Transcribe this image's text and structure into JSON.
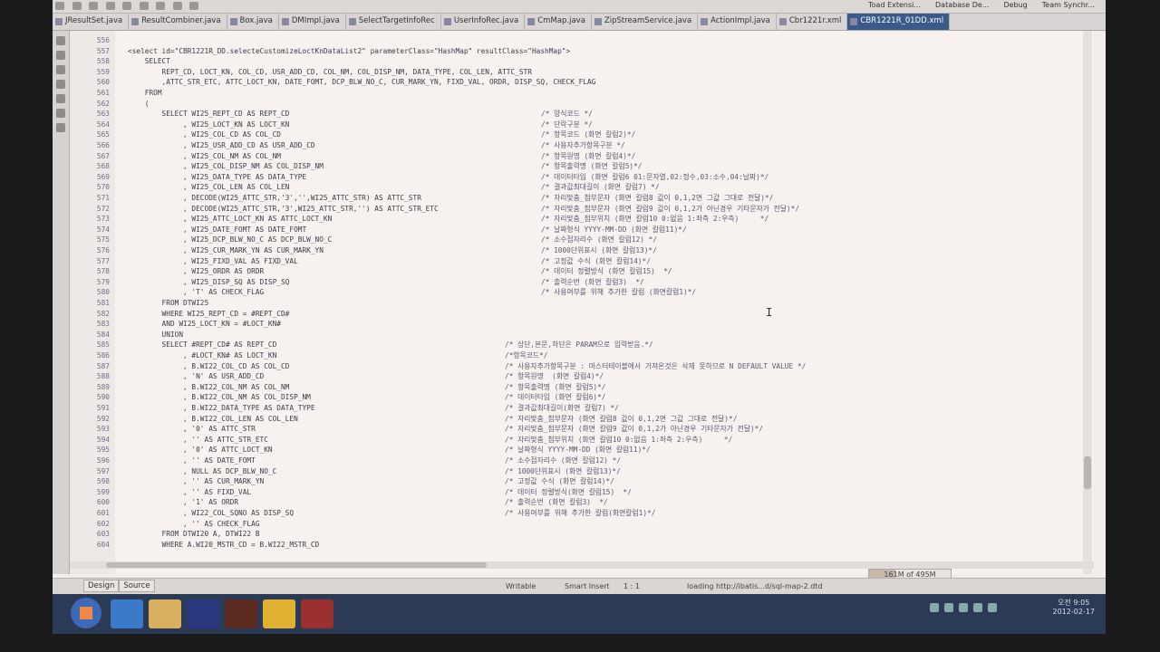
{
  "perspectives": [
    "Toad Extensi...",
    "Database De...",
    "Debug",
    "Team Synchr..."
  ],
  "tabs": [
    {
      "label": "JResultSet.java",
      "active": false
    },
    {
      "label": "ResultCombiner.java",
      "active": false
    },
    {
      "label": "Box.java",
      "active": false
    },
    {
      "label": "DMImpl.java",
      "active": false
    },
    {
      "label": "SelectTargetInfoRec",
      "active": false
    },
    {
      "label": "UserInfoRec.java",
      "active": false
    },
    {
      "label": "CmMap.java",
      "active": false
    },
    {
      "label": "ZipStreamService.java",
      "active": false
    },
    {
      "label": "ActionImpl.java",
      "active": false
    },
    {
      "label": "Cbr1221r.xml",
      "active": false
    },
    {
      "label": "CBR1221R_01DD.xml",
      "active": true
    }
  ],
  "lines": [
    {
      "n": "556",
      "code": "",
      "comment": ""
    },
    {
      "n": "557",
      "code": "<select id=\"CBR1221R_DD.selecteCustomizeLoctKnDataList2\" parameterClass=\"HashMap\" resultClass=\"HashMap\">",
      "comment": ""
    },
    {
      "n": "558",
      "code": "    SELECT",
      "comment": ""
    },
    {
      "n": "559",
      "code": "        REPT_CD, LOCT_KN, COL_CD, USR_ADD_CD, COL_NM, COL_DISP_NM, DATA_TYPE, COL_LEN, ATTC_STR",
      "comment": ""
    },
    {
      "n": "560",
      "code": "        ,ATTC_STR_ETC, ATTC_LOCT_KN, DATE_FOMT, DCP_BLW_NO_C, CUR_MARK_YN, FIXD_VAL, ORDR, DISP_SQ, CHECK_FLAG",
      "comment": ""
    },
    {
      "n": "561",
      "code": "    FROM",
      "comment": ""
    },
    {
      "n": "562",
      "code": "    (",
      "comment": ""
    },
    {
      "n": "563",
      "code": "        SELECT WI25_REPT_CD AS REPT_CD",
      "comment": "/* 양식코드 */"
    },
    {
      "n": "564",
      "code": "             , WI25_LOCT_KN AS LOCT_KN",
      "comment": "/* 단락구분 */"
    },
    {
      "n": "565",
      "code": "             , WI25_COL_CD AS COL_CD",
      "comment": "/* 항목코드 (화면 칼럼2)*/"
    },
    {
      "n": "566",
      "code": "             , WI25_USR_ADD_CD AS USR_ADD_CD",
      "comment": "/* 사용자추가항목구분 */"
    },
    {
      "n": "567",
      "code": "             , WI25_COL_NM AS COL_NM",
      "comment": "/* 항목원명 (화면 칼럼4)*/"
    },
    {
      "n": "568",
      "code": "             , WI25_COL_DISP_NM AS COL_DISP_NM",
      "comment": "/* 항목출력명 (화면 칼럼5)*/"
    },
    {
      "n": "569",
      "code": "             , WI25_DATA_TYPE AS DATA_TYPE",
      "comment": "/* 데이터타입 (화면 칼럼6 01:문자열,02:정수,03:소수,04:날짜)*/"
    },
    {
      "n": "570",
      "code": "             , WI25_COL_LEN AS COL_LEN",
      "comment": "/* 결과값최대길이 (화면 칼럼7) */"
    },
    {
      "n": "571",
      "code": "             , DECODE(WI25_ATTC_STR,'3','',WI25_ATTC_STR) AS ATTC_STR",
      "comment": "/* 자리맞춤_첨부문자 (화면 칼럼8 값이 0,1,2면 그값 그대로 전달)*/"
    },
    {
      "n": "572",
      "code": "             , DECODE(WI25_ATTC_STR,'3',WI25_ATTC_STR,'') AS ATTC_STR_ETC",
      "comment": "/* 자리맞춤_첨부문자 (화면 칼럼9 값이 0,1,2가 아닌경우 기타문자가 전달)*/"
    },
    {
      "n": "573",
      "code": "             , WI25_ATTC_LOCT_KN AS ATTC_LOCT_KN",
      "comment": "/* 자리맞춤_첨부위치 (화면 칼럼10 0:없음 1:좌측 2:우측)     */"
    },
    {
      "n": "574",
      "code": "             , WI25_DATE_FOMT AS DATE_FOMT",
      "comment": "/* 날짜형식 YYYY-MM-DD (화면 칼럼11)*/"
    },
    {
      "n": "575",
      "code": "             , WI25_DCP_BLW_NO_C AS DCP_BLW_NO_C",
      "comment": "/* 소수점자리수 (화면 칼럼12) */"
    },
    {
      "n": "576",
      "code": "             , WI25_CUR_MARK_YN AS CUR_MARK_YN",
      "comment": "/* 1000단위표시 (화면 칼럼13)*/"
    },
    {
      "n": "577",
      "code": "             , WI25_FIXD_VAL AS FIXD_VAL",
      "comment": "/* 고정값 수식 (화면 칼럼14)*/"
    },
    {
      "n": "578",
      "code": "             , WI25_ORDR AS ORDR",
      "comment": "/* 데이터 정렬방식 (화면 칼럼15)  */"
    },
    {
      "n": "579",
      "code": "             , WI25_DISP_SQ AS DISP_SQ",
      "comment": "/* 출력순번 (화면 칼럼3)  */"
    },
    {
      "n": "580",
      "code": "             , 'T' AS CHECK_FLAG",
      "comment": "/* 사용여부를 위해 추가한 칼럼 (화면칼럼1)*/"
    },
    {
      "n": "581",
      "code": "        FROM DTWI25",
      "comment": ""
    },
    {
      "n": "582",
      "code": "        WHERE WI25_REPT_CD = #REPT_CD#",
      "comment": ""
    },
    {
      "n": "583",
      "code": "        AND WI25_LOCT_KN = #LOCT_KN#",
      "comment": ""
    },
    {
      "n": "584",
      "code": "        UNION",
      "comment": ""
    },
    {
      "n": "585",
      "code": "        SELECT #REPT_CD# AS REPT_CD",
      "comment": "/* 상단,본문,하단은 PARAM으로 입력받음.*/"
    },
    {
      "n": "586",
      "code": "             , #LOCT_KN# AS LOCT_KN",
      "comment": "/*항목코드*/"
    },
    {
      "n": "587",
      "code": "             , B.WI22_COL_CD AS COL_CD",
      "comment": "/* 사용자추가항목구분 : 마스터테이블에서 가져온것은 삭제 못하므로 N DEFAULT VALUE */"
    },
    {
      "n": "588",
      "code": "             , 'N' AS USR_ADD_CD",
      "comment": "/* 항목원명  (화면 칼럼4)*/"
    },
    {
      "n": "589",
      "code": "             , B.WI22_COL_NM AS COL_NM",
      "comment": "/* 항목출력명 (화면 칼럼5)*/"
    },
    {
      "n": "590",
      "code": "             , B.WI22_COL_NM AS COL_DISP_NM",
      "comment": "/* 데이터타입 (화면 칼럼6)*/"
    },
    {
      "n": "591",
      "code": "             , B.WI22_DATA_TYPE AS DATA_TYPE",
      "comment": "/* 결과값최대길이(화면 칼럼7) */"
    },
    {
      "n": "592",
      "code": "             , B.WI22_COL_LEN AS COL_LEN",
      "comment": "/* 자리맞춤_첨부문자 (화면 칼럼8 값이 0,1,2면 그값 그대로 전달)*/"
    },
    {
      "n": "593",
      "code": "             , '0' AS ATTC_STR",
      "comment": "/* 자리맞춤_첨부문자 (화면 칼럼9 값이 0,1,2가 아닌경우 기타문자가 전달)*/"
    },
    {
      "n": "594",
      "code": "             , '' AS ATTC_STR_ETC",
      "comment": "/* 자리맞춤_첨부위치 (화면 칼럼10 0:없음 1:좌측 2:우측)     */"
    },
    {
      "n": "595",
      "code": "             , '0' AS ATTC_LOCT_KN",
      "comment": "/* 날짜형식 YYYY-MM-DD (화면 칼럼11)*/"
    },
    {
      "n": "596",
      "code": "             , '' AS DATE_FOMT",
      "comment": "/* 소수점자리수 (화면 칼럼12) */"
    },
    {
      "n": "597",
      "code": "             , NULL AS DCP_BLW_NO_C",
      "comment": "/* 1000단위표시 (화면 칼럼13)*/"
    },
    {
      "n": "598",
      "code": "             , '' AS CUR_MARK_YN",
      "comment": "/* 고정값 수식 (화면 칼럼14)*/"
    },
    {
      "n": "599",
      "code": "             , '' AS FIXD_VAL",
      "comment": "/* 데이터 정렬방식(화면 칼럼15)  */"
    },
    {
      "n": "600",
      "code": "             , '1' AS ORDR",
      "comment": "/* 출력순번 (화면 칼럼3)  */"
    },
    {
      "n": "601",
      "code": "             , WI22_COL_SQNO AS DISP_SQ",
      "comment": "/* 사용여부를 위해 추가한 칼럼(화면칼럼1)*/"
    },
    {
      "n": "602",
      "code": "             , '' AS CHECK_FLAG",
      "comment": ""
    },
    {
      "n": "603",
      "code": "        FROM DTWI20 A, DTWI22 B",
      "comment": ""
    },
    {
      "n": "604",
      "code": "        WHERE A.WI20_MSTR_CD = B.WI22_MSTR_CD",
      "comment": ""
    }
  ],
  "editor_tabs": [
    "Design",
    "Source"
  ],
  "status": {
    "writable": "Writable",
    "insert_mode": "Smart Insert",
    "position": "1 : 1",
    "loading": "loading http://ibatis...d/sql-map-2.dtd",
    "heap": "161M of 495M",
    "heap_fraction": 0.325
  },
  "clock": {
    "time": "오전 9:05",
    "date": "2012-02-17"
  }
}
